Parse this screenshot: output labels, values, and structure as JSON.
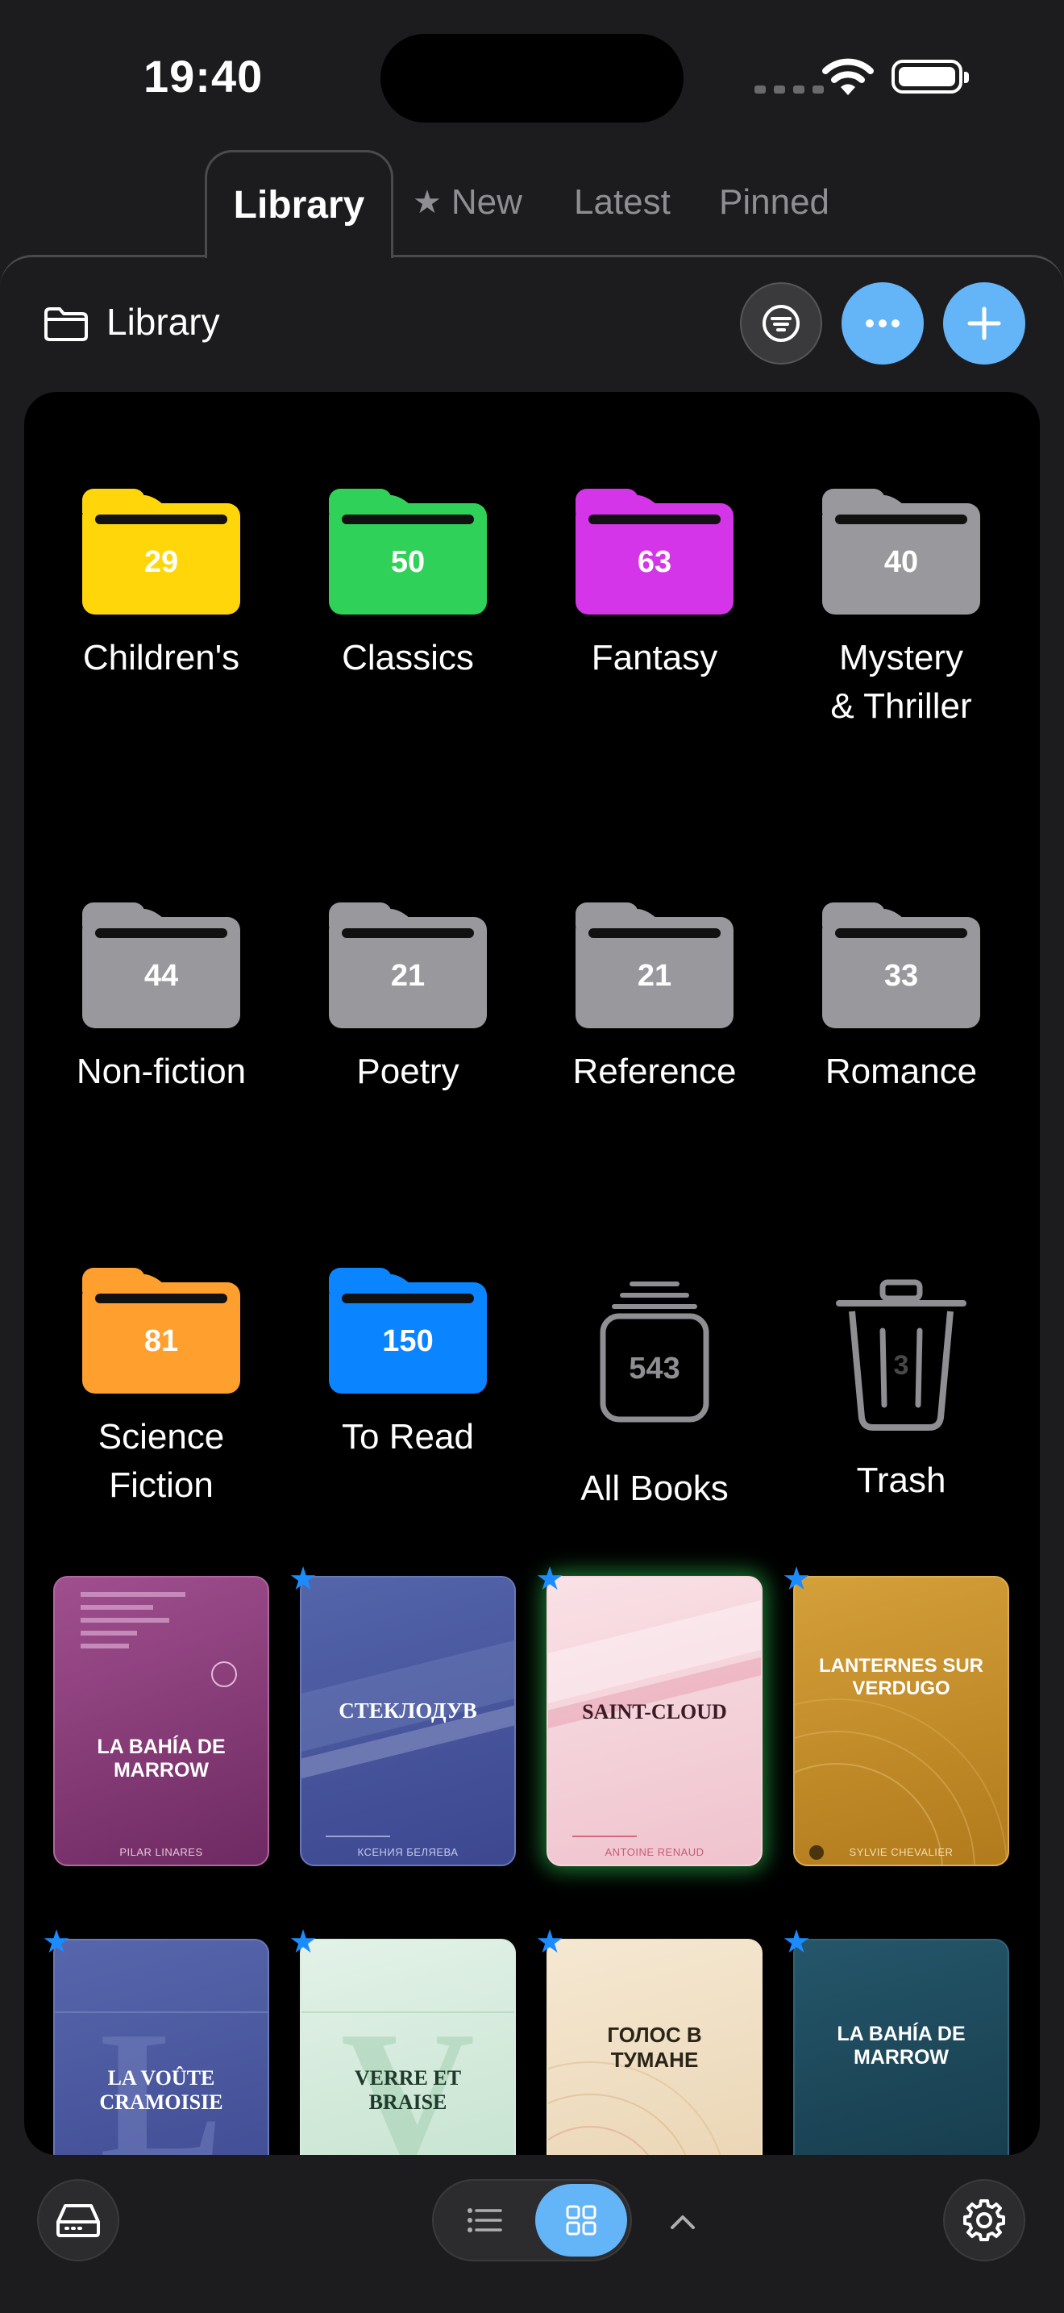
{
  "status_bar": {
    "time": "19:40"
  },
  "tabs": [
    {
      "label": "Library",
      "active": true
    },
    {
      "label": "New",
      "icon": "star-icon"
    },
    {
      "label": "Latest"
    },
    {
      "label": "Pinned"
    }
  ],
  "header": {
    "title": "Library",
    "icon": "folder-icon"
  },
  "folders": [
    {
      "name": "Children's",
      "count": "29",
      "color": "#ffd60a"
    },
    {
      "name": "Classics",
      "count": "50",
      "color": "#30d158"
    },
    {
      "name": "Fantasy",
      "count": "63",
      "color": "#d535e8"
    },
    {
      "name_line1": "Mystery",
      "name_line2": "& Thriller",
      "count": "40",
      "color": "#98989d"
    },
    {
      "name": "Non-fiction",
      "count": "44",
      "color": "#98989d"
    },
    {
      "name": "Poetry",
      "count": "21",
      "color": "#98989d"
    },
    {
      "name": "Reference",
      "count": "21",
      "color": "#98989d"
    },
    {
      "name": "Romance",
      "count": "33",
      "color": "#98989d"
    },
    {
      "name_line1": "Science",
      "name_line2": "Fiction",
      "count": "81",
      "color": "#ff9f2e"
    },
    {
      "name": "To Read",
      "count": "150",
      "color": "#0a84ff"
    }
  ],
  "smart_folders": {
    "all_books": {
      "label": "All Books",
      "count": "543"
    },
    "trash": {
      "label": "Trash",
      "count": "3"
    }
  },
  "books": [
    {
      "title": "LA BAHÍA DE MARROW",
      "author": "PILAR LINARES",
      "pinned": false,
      "progress": 0.12
    },
    {
      "title": "СТЕКЛОДУВ",
      "author": "КСЕНИЯ БЕЛЯЕВА",
      "pinned": true
    },
    {
      "title": "SAINT-CLOUD",
      "author": "ANTOINE RENAUD",
      "pinned": true,
      "selected": true
    },
    {
      "title": "LANTERNES SUR VERDUGO",
      "author": "SYLVIE CHEVALIER",
      "pinned": true
    },
    {
      "title": "LA VOÛTE CRAMOISIE",
      "monogram": "L",
      "pinned": true
    },
    {
      "title": "VERRE ET BRAISE",
      "monogram": "V",
      "pinned": true
    },
    {
      "title": "ГОЛОС В ТУМАНЕ",
      "pinned": true
    },
    {
      "title": "LA BAHÍA DE MARROW",
      "pinned": true
    }
  ],
  "bottom_bar": {
    "view_mode": "grid"
  },
  "colors": {
    "accent": "#64b4f8",
    "pin": "#1a8cff",
    "background": "#1c1c1e"
  }
}
